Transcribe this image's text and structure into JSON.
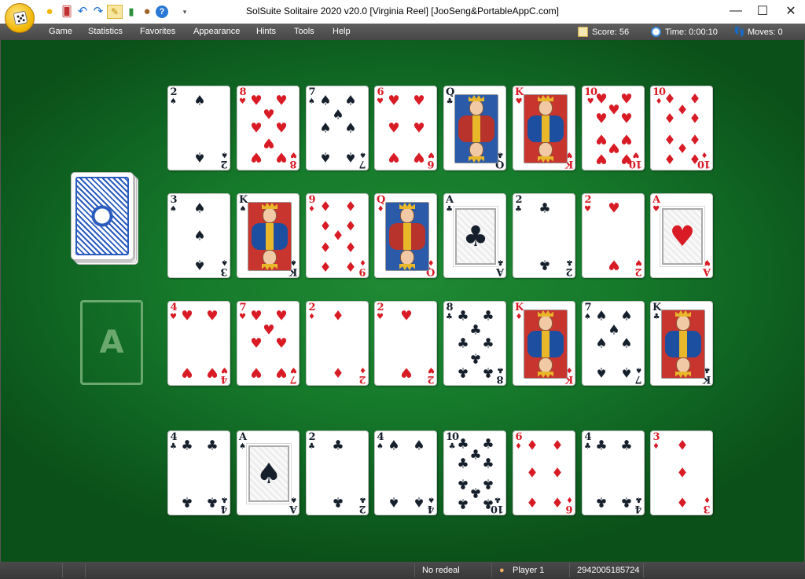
{
  "window": {
    "title": "SolSuite Solitaire 2020 v20.0  [Virginia Reel]  [JooSeng&PortableAppC.com]",
    "minimize": "—",
    "maximize": "☐",
    "close": "✕"
  },
  "toolbar": {
    "icons": [
      "new-game-icon",
      "deal-icon",
      "undo-icon",
      "redo-icon",
      "hint-wand-icon",
      "statistics-icon",
      "cookie-icon",
      "help-icon",
      "customize-dropdown-icon"
    ]
  },
  "menu": {
    "items": [
      "Game",
      "Statistics",
      "Favorites",
      "Appearance",
      "Hints",
      "Tools",
      "Help"
    ]
  },
  "stats": {
    "score": "Score:  56",
    "time": "Time:  0:00:10",
    "moves": "Moves:  0"
  },
  "foundation": {
    "label": "A"
  },
  "tableau": {
    "rows": [
      [
        {
          "rank": "2",
          "suit": "♠",
          "color": "black"
        },
        {
          "rank": "8",
          "suit": "♥",
          "color": "red"
        },
        {
          "rank": "7",
          "suit": "♠",
          "color": "black"
        },
        {
          "rank": "6",
          "suit": "♥",
          "color": "red"
        },
        {
          "rank": "Q",
          "suit": "♣",
          "color": "black"
        },
        {
          "rank": "K",
          "suit": "♥",
          "color": "red"
        },
        {
          "rank": "10",
          "suit": "♥",
          "color": "red"
        },
        {
          "rank": "10",
          "suit": "♦",
          "color": "red"
        }
      ],
      [
        {
          "rank": "3",
          "suit": "♠",
          "color": "black"
        },
        {
          "rank": "K",
          "suit": "♠",
          "color": "black"
        },
        {
          "rank": "9",
          "suit": "♦",
          "color": "red"
        },
        {
          "rank": "Q",
          "suit": "♦",
          "color": "red"
        },
        {
          "rank": "A",
          "suit": "♣",
          "color": "black"
        },
        {
          "rank": "2",
          "suit": "♣",
          "color": "black"
        },
        {
          "rank": "2",
          "suit": "♥",
          "color": "red"
        },
        {
          "rank": "A",
          "suit": "♥",
          "color": "red"
        }
      ],
      [
        {
          "rank": "4",
          "suit": "♥",
          "color": "red"
        },
        {
          "rank": "7",
          "suit": "♥",
          "color": "red"
        },
        {
          "rank": "2",
          "suit": "♦",
          "color": "red"
        },
        {
          "rank": "2",
          "suit": "♥",
          "color": "red"
        },
        {
          "rank": "8",
          "suit": "♣",
          "color": "black"
        },
        {
          "rank": "K",
          "suit": "♦",
          "color": "red"
        },
        {
          "rank": "7",
          "suit": "♠",
          "color": "black"
        },
        {
          "rank": "K",
          "suit": "♣",
          "color": "black"
        }
      ],
      [
        {
          "rank": "4",
          "suit": "♣",
          "color": "black"
        },
        {
          "rank": "A",
          "suit": "♠",
          "color": "black"
        },
        {
          "rank": "2",
          "suit": "♣",
          "color": "black"
        },
        {
          "rank": "4",
          "suit": "♠",
          "color": "black"
        },
        {
          "rank": "10",
          "suit": "♣",
          "color": "black"
        },
        {
          "rank": "6",
          "suit": "♦",
          "color": "red"
        },
        {
          "rank": "4",
          "suit": "♣",
          "color": "black"
        },
        {
          "rank": "3",
          "suit": "♦",
          "color": "red"
        }
      ]
    ]
  },
  "status": {
    "redeal": "No redeal",
    "player": "Player 1",
    "game_number": "2942005185724"
  },
  "colors": {
    "felt": "#167a2b",
    "menubar": "#4f4f4f",
    "red_suit": "#d81b25",
    "black_suit": "#16202c",
    "card_back": "#2a5bbf"
  }
}
